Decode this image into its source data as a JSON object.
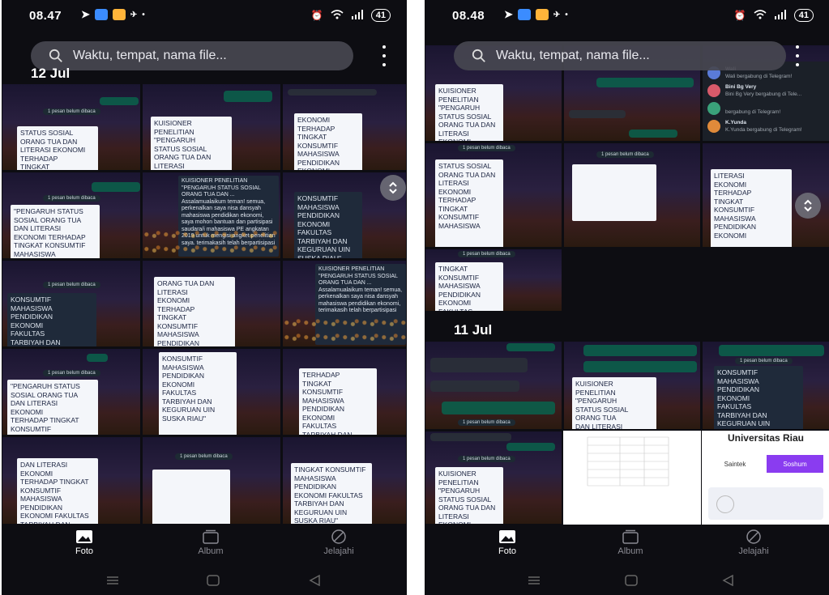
{
  "left_phone": {
    "status": {
      "time": "08.47",
      "battery": "41"
    },
    "search": {
      "placeholder": "Waktu, tempat, nama file..."
    },
    "date_header": "12 Jul",
    "tiles": [
      {
        "doc": "STATUS SOSIAL\nORANG TUA DAN\nLITERASI EKONOMI\nTERHADAP\nTINGKAT\nKONSUMTIF\nMAHASISWA\nPENDIDIKAN"
      },
      {
        "doc": "KUISIONER\nPENELITIAN\n\"PENGARUH\nSTATUS SOSIAL\nORANG TUA DAN\nLITERASI\nEKONOMI\nTERHADAP\nTINGKAT"
      },
      {
        "doc": "EKONOMI\nTERHADAP\nTINGKAT\nKONSUMTIF\nMAHASISWA\nPENDIDIKAN\nEKONOMI\nFAKULTAS\nTARBIYAH DAN\nKEGURUAN UIN"
      },
      {
        "doc": "\"PENGARUH STATUS\nSOSIAL ORANG TUA\nDAN LITERASI\nEKONOMI TERHADAP\nTINGKAT KONSUMTIF\nMAHASISWA\nPENDIDIKAN\nEKONOMI FAKULTAS\nTARBIYAH DAN\nKEGURUAN UIN SUSKA"
      },
      {
        "doc": "KUISIONER PENELITIAN \"PENGARUH STATUS SOSIAL ORANG TUA DAN ...\nAssalamualaikum teman! semua, perkenalkan saya nisa dansyah mahasiswa pendidikan ekonomi, saya mohon bantuan dan partisipasi saudara/i mahasiswa PE angkatan 2019 untuk mengisi angket penelitian saya. terimakasih telah berpartisipasi"
      },
      {
        "doc": "KONSUMTIF\nMAHASISWA\nPENDIDIKAN\nEKONOMI\nFAKULTAS\nTARBIYAH DAN\nKEGURUAN UIN\nSUSKA RIAU\""
      },
      {
        "doc": "KONSUMTIF\nMAHASISWA\nPENDIDIKAN\nEKONOMI\nFAKULTAS\nTARBIYAH DAN\nKEGURUAN UIN\nSUSKA RIAU\""
      },
      {
        "doc": "ORANG TUA DAN\nLITERASI\nEKONOMI\nTERHADAP\nTINGKAT\nKONSUMTIF\nMAHASISWA\nPENDIDIKAN\nEKONOMI\nFAKULTAS\nTARBIYAH DAN"
      },
      {
        "doc": "KUISIONER PENELITIAN \"PENGARUH STATUS SOSIAL ORANG TUA DAN ...\nAssalamualaikum teman! semua, perkenalkan saya nisa dansyah mahasiswa pendidikan ekonomi, terimakasih telah berpartisipasi"
      },
      {
        "doc": "\"PENGARUH STATUS\nSOSIAL ORANG TUA\nDAN LITERASI\nEKONOMI\nTERHADAP TINGKAT\nKONSUMTIF\nMAHASISWA\nPENDIDIKAN\nEKONOMI FAKULTAS"
      },
      {
        "doc": "KONSUMTIF\nMAHASISWA\nPENDIDIKAN\nEKONOMI\nFAKULTAS\nTARBIYAH DAN\nKEGURUAN UIN\nSUSKA RIAU\""
      },
      {
        "doc": "TERHADAP\nTINGKAT\nKONSUMTIF\nMAHASISWA\nPENDIDIKAN\nEKONOMI\nFAKULTAS\nTARBIYAH DAN\nKEGURUAN UIN"
      },
      {
        "doc": "DAN LITERASI\nEKONOMI\nTERHADAP TINGKAT\nKONSUMTIF\nMAHASISWA\nPENDIDIKAN\nEKONOMI FAKULTAS\nTARBIYAH DAN\nKEGURUAN UIN\nSUSKA RIAU\""
      },
      {
        "doc": ""
      },
      {
        "doc": "TINGKAT KONSUMTIF\nMAHASISWA\nPENDIDIKAN\nEKONOMI FAKULTAS\nTARBIYAH DAN\nKEGURUAN UIN\nSUSKA RIAU\""
      }
    ],
    "unread_label": "1 pesan belum dibaca",
    "nav": {
      "foto": "Foto",
      "album": "Album",
      "jelajahi": "Jelajahi"
    }
  },
  "right_phone": {
    "status": {
      "time": "08.48",
      "battery": "41"
    },
    "search": {
      "placeholder": "Waktu, tempat, nama file..."
    },
    "date_header": "11 Jul",
    "tiles_top": [
      {
        "doc": "KUISIONER\nPENELITIAN\n\"PENGARUH\nSTATUS SOSIAL\nORANG TUA DAN\nLITERASI\nEKONOMI\nTERHADAP"
      },
      {
        "doc": "STATUS SOSIAL\nORANG TUA DAN\nLITERASI\nEKONOMI\nTERHADAP\nTINGKAT\nKONSUMTIF\nMAHASISWA"
      },
      {
        "doc": "LITERASI\nEKONOMI\nTERHADAP\nTINGKAT\nKONSUMTIF\nMAHASISWA\nPENDIDIKAN\nEKONOMI"
      },
      {
        "doc": "TINGKAT\nKONSUMTIF\nMAHASISWA\nPENDIDIKAN\nEKONOMI\nFAKULTAS\nTARBIYAH DAN\nKEGURUAN UIN"
      }
    ],
    "chat_list": [
      {
        "name": "Wali",
        "msg": "Wali bergabung di Telegram!",
        "color": "#5a7bd8"
      },
      {
        "name": "Bini Bg Very",
        "msg": "Bini Bg Very bergabung di Tele...",
        "color": "#d85a6a"
      },
      {
        "name": "",
        "msg": "bergabung di Telegram!",
        "color": "#3aa27a"
      },
      {
        "name": "K.Yunda",
        "msg": "K.Yunda bergabung di Telegram!",
        "color": "#e08a3a"
      }
    ],
    "tiles_bottom": [
      {
        "doc": "KUISIONER\nPENELITIAN\n\"PENGARUH\nSTATUS SOSIAL\nORANG TUA\nDAN LITERASI\nEKONOMI\nTERHADAP TINGKAT\nKONSUMTIF\nMAHASISWA"
      },
      {
        "doc": "KONSUMTIF\nMAHASISWA\nPENDIDIKAN\nEKONOMI\nFAKULTAS\nTARBIYAH DAN\nKEGURUAN UIN\nSUSKA RIAU\""
      },
      {
        "doc": "KUISIONER\nPENELITIAN\n\"PENGARUH\nSTATUS SOSIAL\nORANG TUA DAN\nLITERASI\nEKONOMI\nTERHADAP"
      }
    ],
    "univ": {
      "title": "Universitas Riau",
      "tab1": "Saintek",
      "tab2": "Soshum"
    },
    "unread_label": "1 pesan belum dibaca",
    "nav": {
      "foto": "Foto",
      "album": "Album",
      "jelajahi": "Jelajahi"
    }
  }
}
